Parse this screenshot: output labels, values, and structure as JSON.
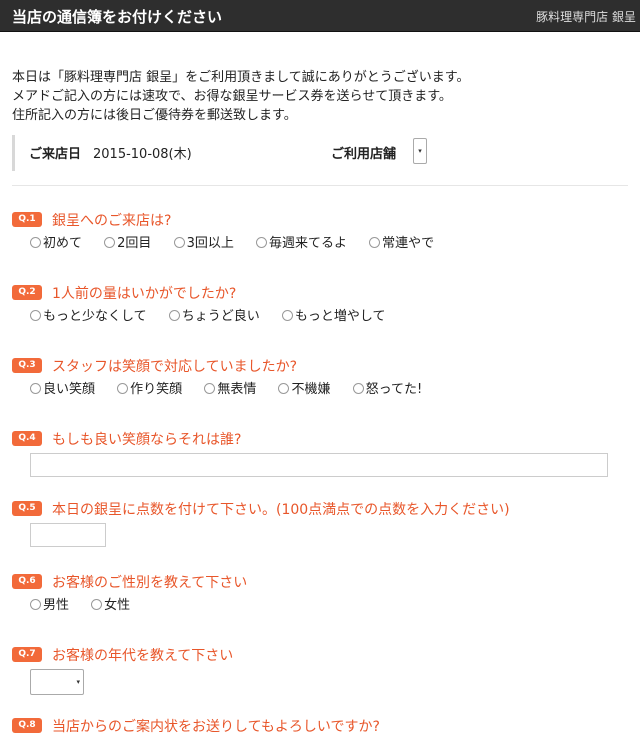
{
  "header": {
    "title": "当店の通信簿をお付けください",
    "shop": "豚料理専門店 銀呈"
  },
  "intro": {
    "line1": "本日は「豚料理専門店 銀呈」をご利用頂きまして誠にありがとうございます。",
    "line2": "メアドご記入の方には速攻で、お得な銀呈サービス券を送らせて頂きます。",
    "line3": "住所記入の方には後日ご優待券を郵送致します。"
  },
  "visit": {
    "date_label": "ご来店日",
    "date_value": "2015-10-08(木)",
    "store_label": "ご利用店舗",
    "store_arrow": "▾"
  },
  "questions": [
    {
      "badge": "Q.1",
      "text": "銀呈へのご来店は?",
      "options": [
        "初めて",
        "2回目",
        "3回以上",
        "毎週来てるよ",
        "常連やで"
      ]
    },
    {
      "badge": "Q.2",
      "text": "1人前の量はいかがでしたか?",
      "options": [
        "もっと少なくして",
        "ちょうど良い",
        "もっと増やして"
      ]
    },
    {
      "badge": "Q.3",
      "text": "スタッフは笑顔で対応していましたか?",
      "options": [
        "良い笑顔",
        "作り笑顔",
        "無表情",
        "不機嫌",
        "怒ってた!"
      ]
    },
    {
      "badge": "Q.4",
      "text": "もしも良い笑顔ならそれは誰?"
    },
    {
      "badge": "Q.5",
      "text": "本日の銀呈に点数を付けて下さい。(100点満点での点数を入力ください)"
    },
    {
      "badge": "Q.6",
      "text": "お客様のご性別を教えて下さい",
      "options": [
        "男性",
        "女性"
      ]
    },
    {
      "badge": "Q.7",
      "text": "お客様の年代を教えて下さい",
      "select_arrow": "▾"
    },
    {
      "badge": "Q.8",
      "text": "当店からのご案内状をお送りしてもよろしいですか?"
    }
  ]
}
